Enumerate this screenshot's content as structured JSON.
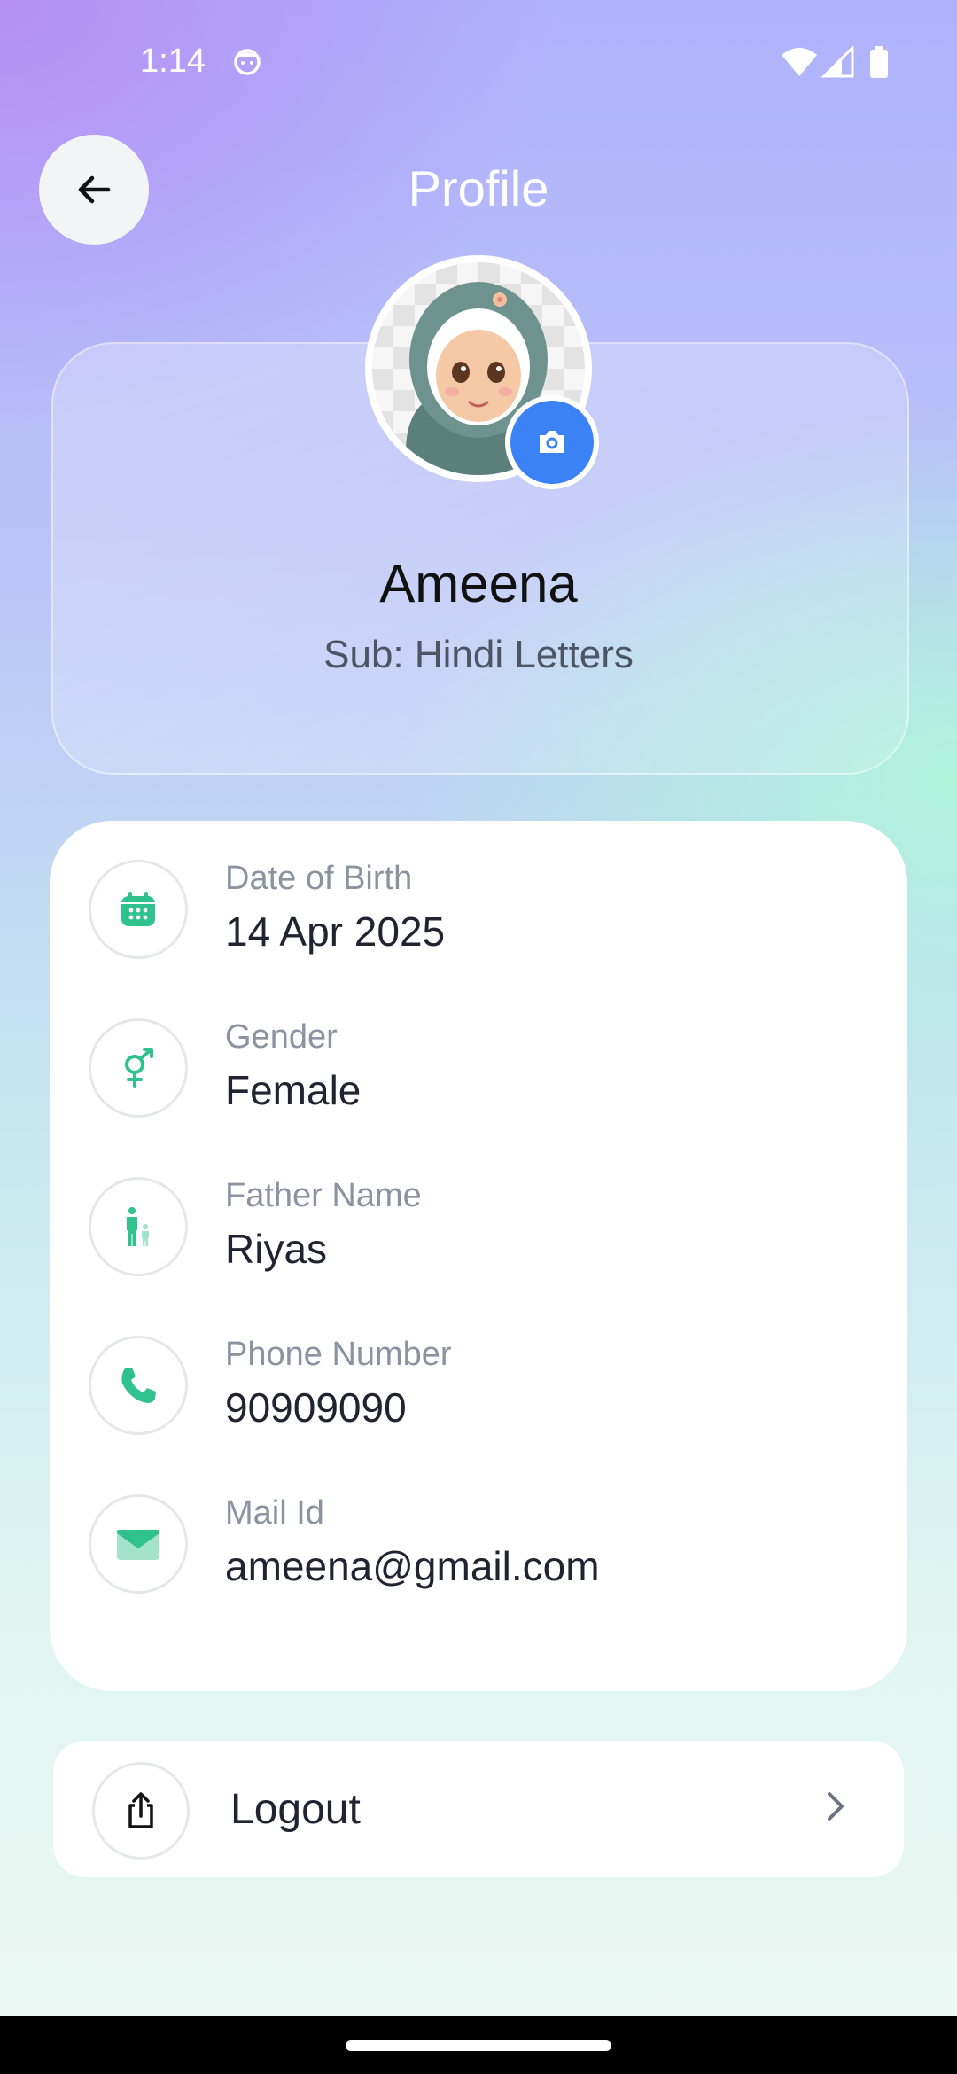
{
  "status_bar": {
    "time": "1:14",
    "face_icon": "face-icon",
    "wifi_icon": "wifi-icon",
    "signal_icon": "signal-icon",
    "battery_icon": "battery-icon"
  },
  "header": {
    "title": "Profile",
    "back_icon": "arrow-left-icon"
  },
  "profile": {
    "name": "Ameena",
    "subject": "Sub: Hindi Letters",
    "camera_icon": "camera-icon"
  },
  "details": [
    {
      "icon": "calendar-icon",
      "label": "Date of Birth",
      "value": "14 Apr 2025"
    },
    {
      "icon": "gender-icon",
      "label": "Gender",
      "value": "Female"
    },
    {
      "icon": "parent-child-icon",
      "label": "Father Name",
      "value": "Riyas"
    },
    {
      "icon": "phone-icon",
      "label": "Phone Number",
      "value": "90909090"
    },
    {
      "icon": "mail-icon",
      "label": "Mail Id",
      "value": "ameena@gmail.com"
    }
  ],
  "logout": {
    "label": "Logout",
    "icon": "share-icon",
    "chevron": "chevron-right-icon"
  },
  "colors": {
    "accent_green": "#2fc28f",
    "camera_blue": "#3b82f6",
    "label_gray": "#8b93a1",
    "value_dark": "#1f2430"
  }
}
